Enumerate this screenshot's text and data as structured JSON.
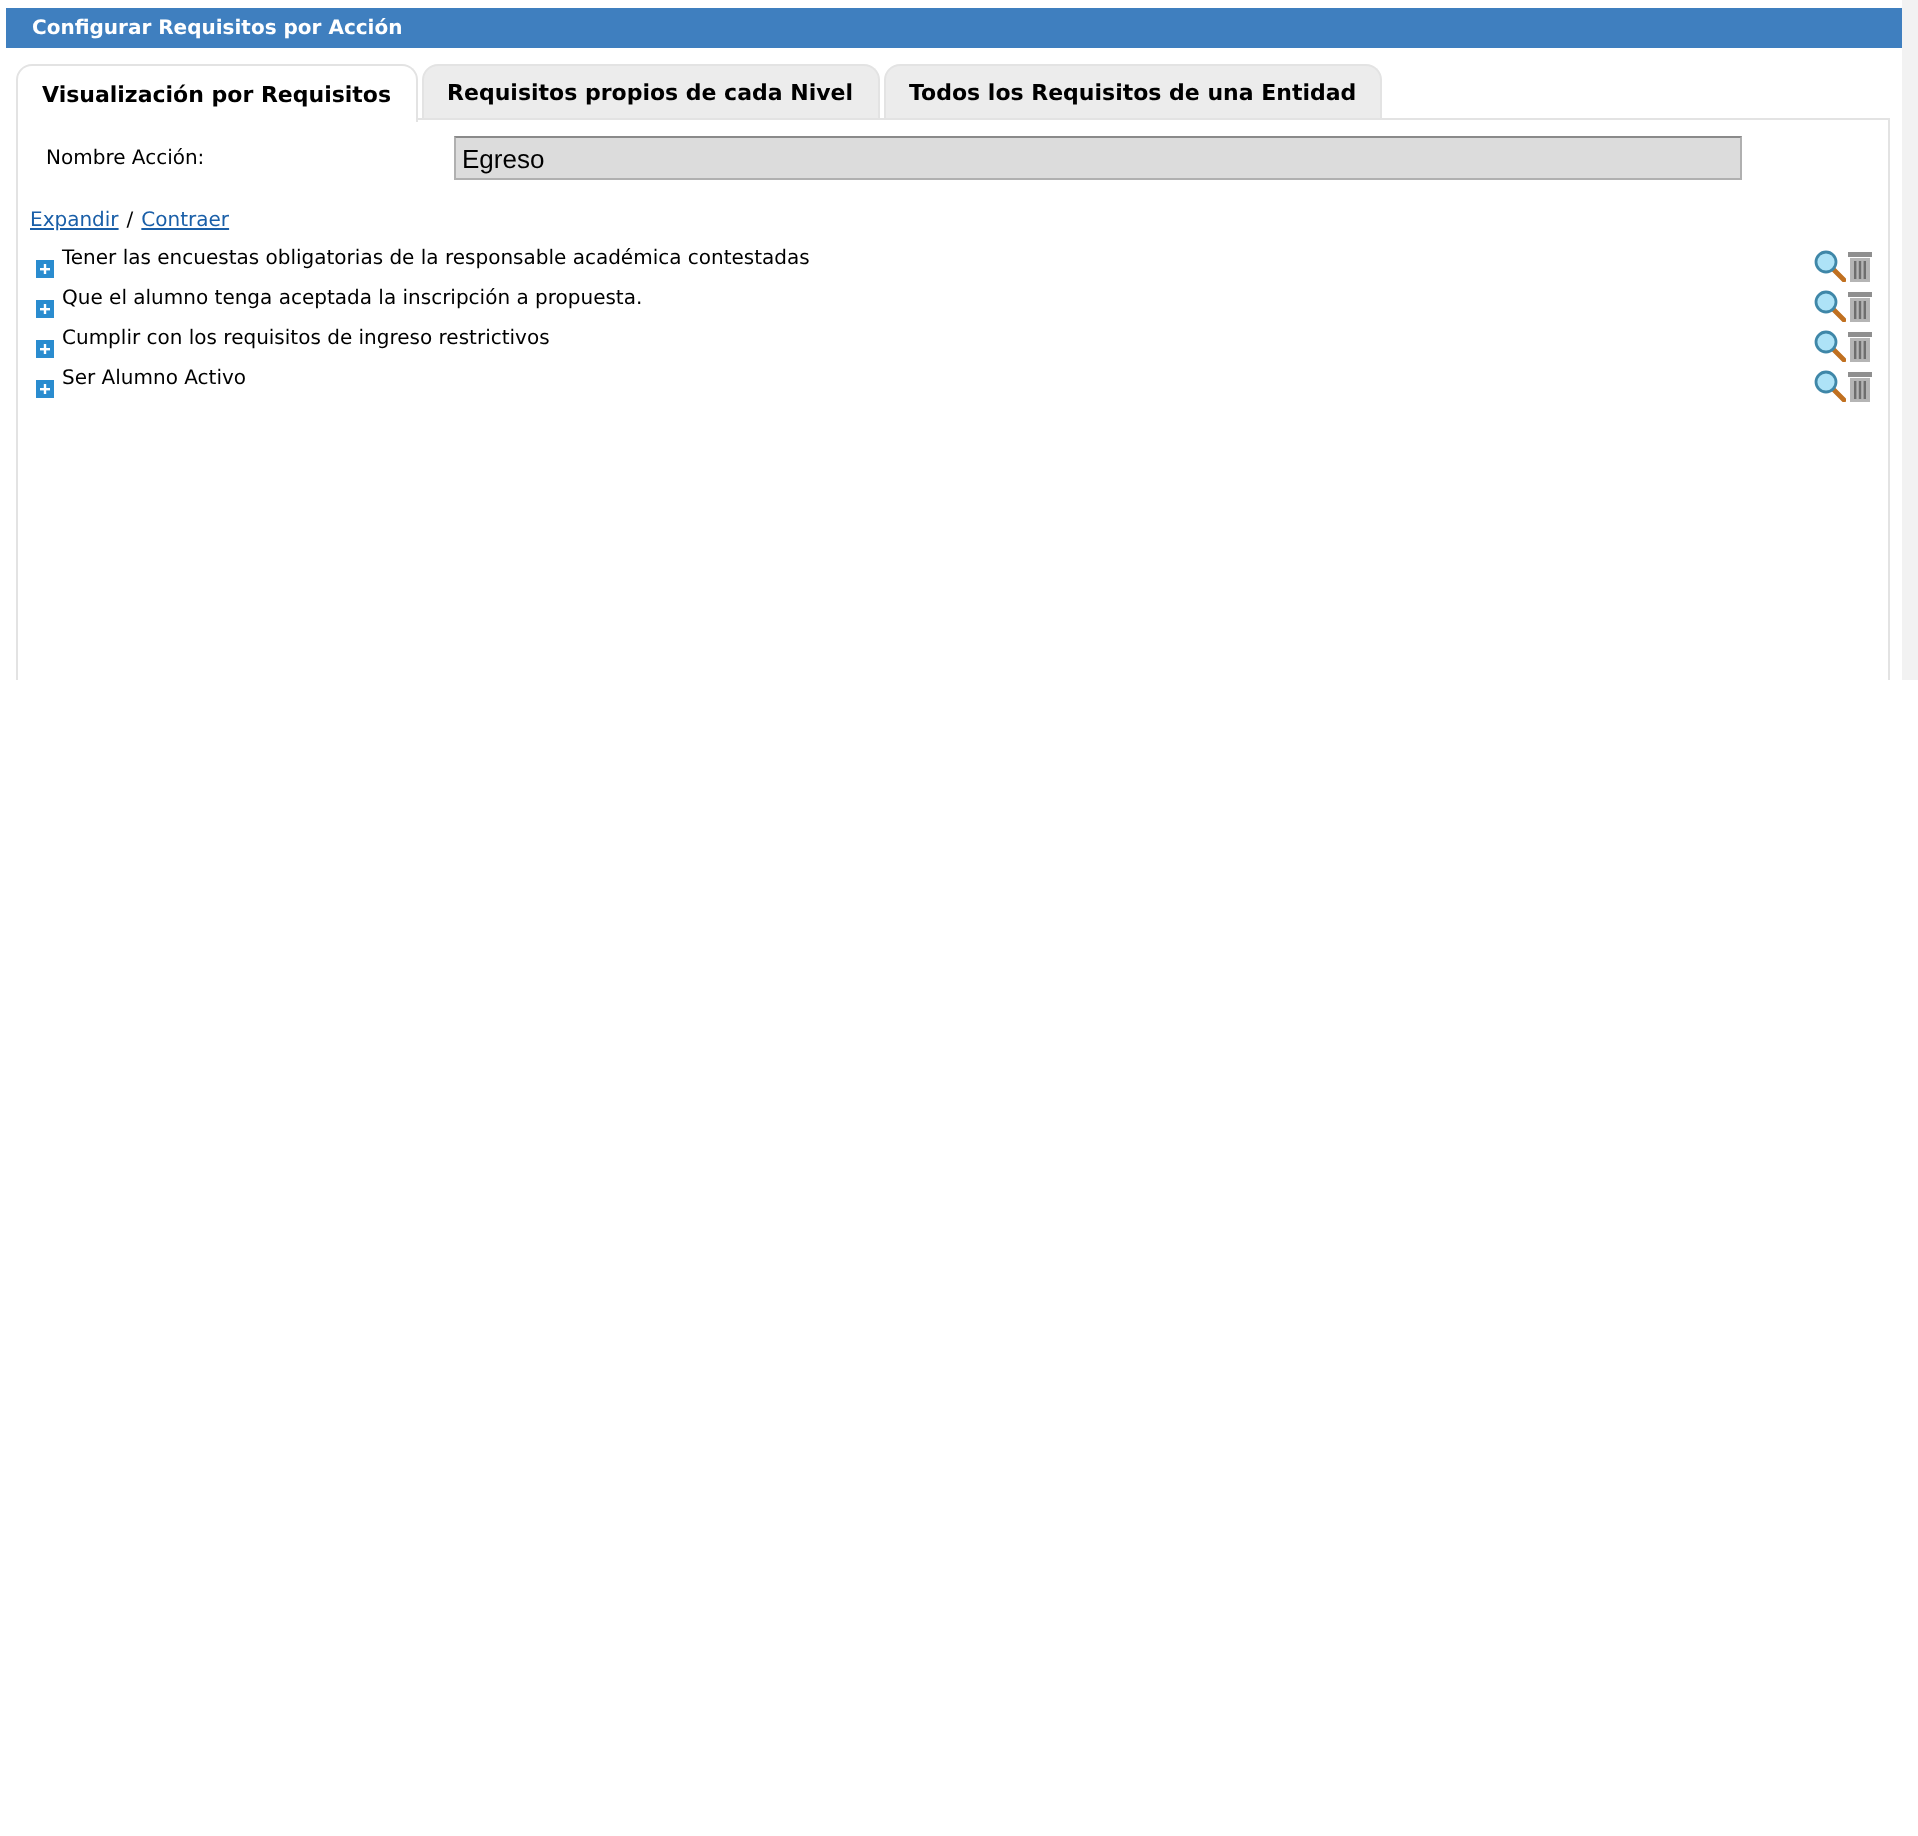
{
  "panel": {
    "title": "Configurar Requisitos por Acción"
  },
  "tabs": [
    {
      "label": "Visualización por Requisitos",
      "selected": true
    },
    {
      "label": "Requisitos propios de cada Nivel",
      "selected": false
    },
    {
      "label": "Todos los Requisitos de una Entidad",
      "selected": false
    }
  ],
  "action_field": {
    "label": "Nombre Acción:",
    "value": "Egreso"
  },
  "tree_links": {
    "expand": "Expandir",
    "separator": "/",
    "collapse": "Contraer"
  },
  "requirements": [
    {
      "label": "Tener las encuestas obligatorias de la responsable académica contestadas",
      "expanded": false
    },
    {
      "label": "Que el alumno tenga aceptada la inscripción a propuesta.",
      "expanded": false
    },
    {
      "label": "Cumplir con los requisitos de ingreso restrictivos",
      "expanded": false
    },
    {
      "label": "Ser Alumno Activo",
      "expanded": false
    }
  ]
}
